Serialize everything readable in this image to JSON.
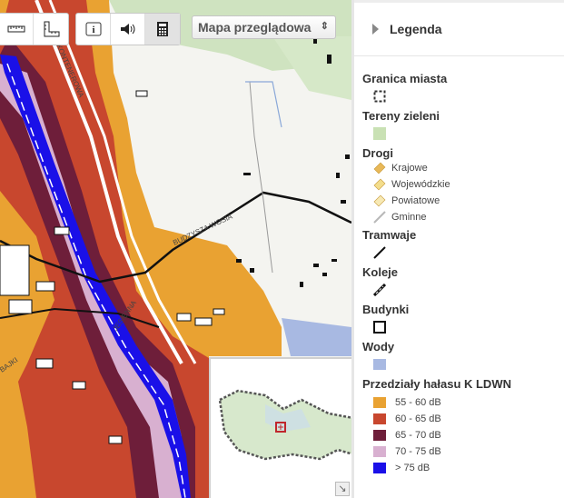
{
  "toolbar": {
    "buttons": [
      {
        "icon": "ruler-horizontal-icon"
      },
      {
        "icon": "ruler-area-icon"
      },
      {
        "icon": "info-icon"
      },
      {
        "icon": "speaker-icon"
      },
      {
        "icon": "calculator-icon"
      }
    ]
  },
  "map_select": {
    "value": "Mapa przeglądowa",
    "arrow": "⇕"
  },
  "map_labels": {
    "street_north": "KONTENEROWA",
    "street_east": "BUDZYSZA WOSIA",
    "street_south": "JESIENNA",
    "street_west": "BAJKI"
  },
  "legend": {
    "header": "Legenda",
    "city_border": "Granica miasta",
    "green": "Tereny zieleni",
    "roads": {
      "title": "Drogi",
      "items": [
        "Krajowe",
        "Wojewódzkie",
        "Powiatowe",
        "Gminne"
      ],
      "colors": [
        "#e8b858",
        "#f3dd8c",
        "#f7e9b4",
        "#b8b8b8"
      ]
    },
    "tram": "Tramwaje",
    "rail": "Koleje",
    "buildings": "Budynki",
    "water": "Wody",
    "noise": {
      "title": "Przedziały hałasu K LDWN",
      "items": [
        "55 - 60 dB",
        "60 - 65 dB",
        "65 - 70 dB",
        "70 - 75 dB",
        "> 75 dB"
      ],
      "colors": [
        "#e9a232",
        "#c8472e",
        "#6e1e3a",
        "#d8b0d0",
        "#1a10e8"
      ]
    }
  },
  "colors": {
    "green": "#c9e1b4",
    "water": "#a8b9e2",
    "background": "#f4f4f0"
  }
}
